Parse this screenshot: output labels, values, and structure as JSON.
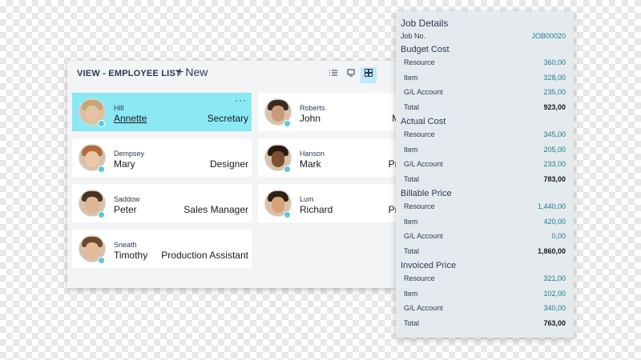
{
  "header": {
    "view_title": "VIEW - EMPLOYEE LIST",
    "new_label": "New",
    "new_icon": "plus-icon",
    "view_icons": [
      "list-view-icon",
      "tile-small-icon",
      "tile-grid-icon"
    ]
  },
  "employees": [
    {
      "surname": "Hill",
      "first": "Annette",
      "role": "Secretary",
      "selected": true
    },
    {
      "surname": "Roberts",
      "first": "John",
      "role": "Managing"
    },
    {
      "surname": "Dempsey",
      "first": "Mary",
      "role": "Designer"
    },
    {
      "surname": "Hanson",
      "first": "Mark",
      "role": "Production"
    },
    {
      "surname": "Saddow",
      "first": "Peter",
      "role": "Sales Manager"
    },
    {
      "surname": "Lum",
      "first": "Richard",
      "role": "Production"
    },
    {
      "surname": "Sneath",
      "first": "Timothy",
      "role": "Production Assistant"
    }
  ],
  "card_menu": "···",
  "job": {
    "title": "Job Details",
    "job_no_label": "Job No.",
    "job_no": "JOB00020",
    "sections": [
      {
        "title": "Budget Cost",
        "rows": [
          {
            "label": "Resource",
            "value": "360,00"
          },
          {
            "label": "Item",
            "value": "328,00"
          },
          {
            "label": "G/L Account",
            "value": "235,00"
          },
          {
            "label": "Total",
            "value": "923,00"
          }
        ]
      },
      {
        "title": "Actual Cost",
        "rows": [
          {
            "label": "Resource",
            "value": "345,00"
          },
          {
            "label": "Item",
            "value": "205,00"
          },
          {
            "label": "G/L Account",
            "value": "233,00"
          },
          {
            "label": "Total",
            "value": "783,00"
          }
        ]
      },
      {
        "title": "Billable Price",
        "rows": [
          {
            "label": "Resource",
            "value": "1,440,00"
          },
          {
            "label": "Item",
            "value": "420,00"
          },
          {
            "label": "G/L Account",
            "value": "0,00"
          },
          {
            "label": "Total",
            "value": "1,860,00"
          }
        ]
      },
      {
        "title": "Invoiced Price",
        "rows": [
          {
            "label": "Resource",
            "value": "321,00"
          },
          {
            "label": "Item",
            "value": "102,00"
          },
          {
            "label": "G/L Account",
            "value": "340,00"
          },
          {
            "label": "Total",
            "value": "763,00"
          }
        ]
      }
    ]
  },
  "colors": {
    "selected_card": "#8be8f5",
    "accent": "#1a7f8a",
    "status": "#5ac8dc"
  }
}
